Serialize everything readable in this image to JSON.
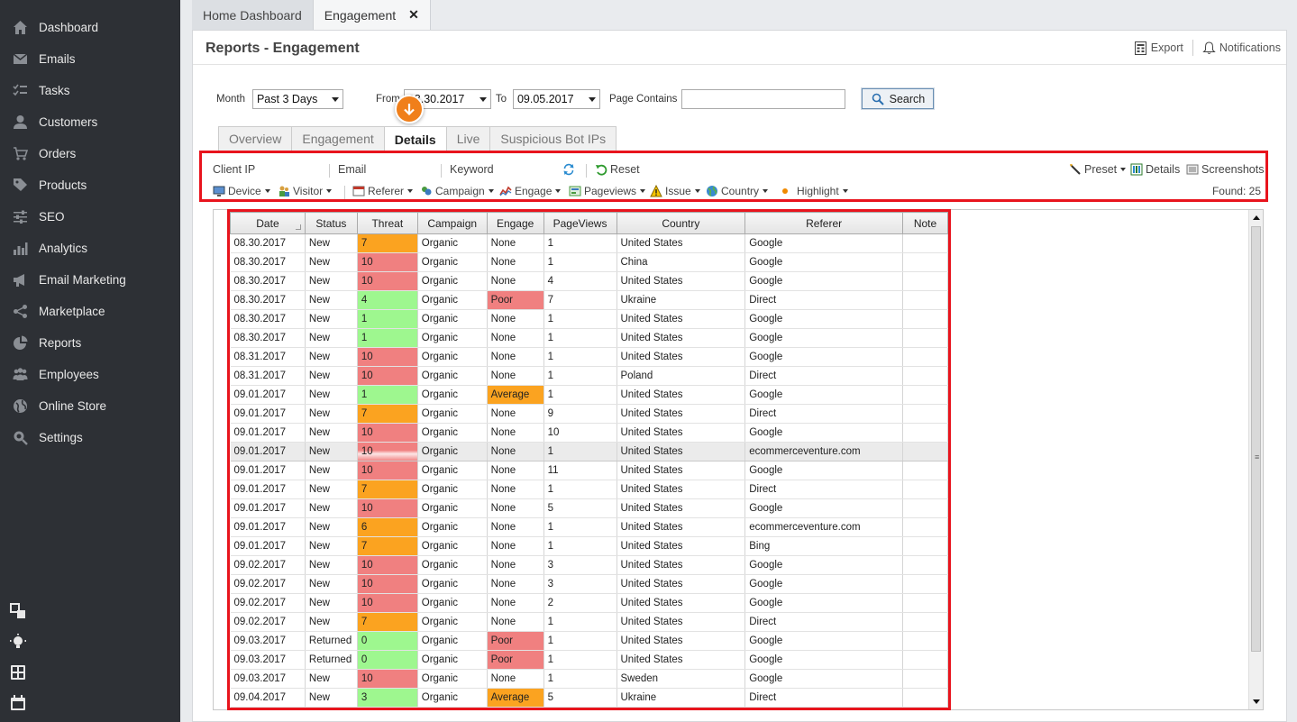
{
  "sidebar": {
    "items": [
      {
        "label": "Dashboard",
        "icon": "home-icon"
      },
      {
        "label": "Emails",
        "icon": "envelope-icon"
      },
      {
        "label": "Tasks",
        "icon": "tasks-icon"
      },
      {
        "label": "Customers",
        "icon": "user-icon"
      },
      {
        "label": "Orders",
        "icon": "cart-icon"
      },
      {
        "label": "Products",
        "icon": "tag-icon"
      },
      {
        "label": "SEO",
        "icon": "sliders-icon"
      },
      {
        "label": "Analytics",
        "icon": "bar-chart-icon"
      },
      {
        "label": "Email Marketing",
        "icon": "megaphone-icon"
      },
      {
        "label": "Marketplace",
        "icon": "share-icon"
      },
      {
        "label": "Reports",
        "icon": "pie-chart-icon"
      },
      {
        "label": "Employees",
        "icon": "group-icon"
      },
      {
        "label": "Online Store",
        "icon": "globe-icon"
      },
      {
        "label": "Settings",
        "icon": "gear-search-icon"
      }
    ]
  },
  "doc_tabs": {
    "home": "Home Dashboard",
    "engagement": "Engagement",
    "close": "✕"
  },
  "header": {
    "title": "Reports - Engagement",
    "export": "Export",
    "notifications": "Notifications"
  },
  "filters": {
    "month_label": "Month",
    "month_value": "Past 3 Days",
    "from_label": "From",
    "from_value": "08.30.2017",
    "to_label": "To",
    "to_value": "09.05.2017",
    "page_contains_label": "Page Contains",
    "page_contains_value": "",
    "search": "Search"
  },
  "sub_tabs": [
    "Overview",
    "Engagement",
    "Details",
    "Live",
    "Suspicious Bot IPs"
  ],
  "toolbar": {
    "client_ip": "Client IP",
    "email": "Email",
    "keyword": "Keyword",
    "reset": "Reset",
    "preset": "Preset",
    "details": "Details",
    "screenshots": "Screenshots",
    "device": "Device",
    "visitor": "Visitor",
    "referer": "Referer",
    "campaign": "Campaign",
    "engage": "Engage",
    "pageviews": "Pageviews",
    "issue": "Issue",
    "country": "Country",
    "highlight": "Highlight",
    "found": "Found: 25"
  },
  "grid": {
    "columns": [
      "Date",
      "Status",
      "Threat",
      "Campaign",
      "Engage",
      "PageViews",
      "Country",
      "Referer",
      "Note"
    ],
    "colors": {
      "orange": "#fba320",
      "red": "#f08080",
      "green": "#9ef78f"
    },
    "rows": [
      [
        "08.30.2017",
        "New",
        "7",
        "Organic",
        "None",
        "1",
        "United States",
        "Google",
        ""
      ],
      [
        "08.30.2017",
        "New",
        "10",
        "Organic",
        "None",
        "1",
        "China",
        "Google",
        ""
      ],
      [
        "08.30.2017",
        "New",
        "10",
        "Organic",
        "None",
        "4",
        "United States",
        "Google",
        ""
      ],
      [
        "08.30.2017",
        "New",
        "4",
        "Organic",
        "Poor",
        "7",
        "Ukraine",
        "Direct",
        ""
      ],
      [
        "08.30.2017",
        "New",
        "1",
        "Organic",
        "None",
        "1",
        "United States",
        "Google",
        ""
      ],
      [
        "08.30.2017",
        "New",
        "1",
        "Organic",
        "None",
        "1",
        "United States",
        "Google",
        ""
      ],
      [
        "08.31.2017",
        "New",
        "10",
        "Organic",
        "None",
        "1",
        "United States",
        "Google",
        ""
      ],
      [
        "08.31.2017",
        "New",
        "10",
        "Organic",
        "None",
        "1",
        "Poland",
        "Direct",
        ""
      ],
      [
        "09.01.2017",
        "New",
        "1",
        "Organic",
        "Average",
        "1",
        "United States",
        "Google",
        ""
      ],
      [
        "09.01.2017",
        "New",
        "7",
        "Organic",
        "None",
        "9",
        "United States",
        "Direct",
        ""
      ],
      [
        "09.01.2017",
        "New",
        "10",
        "Organic",
        "None",
        "10",
        "United States",
        "Google",
        ""
      ],
      [
        "09.01.2017",
        "New",
        "10",
        "Organic",
        "None",
        "1",
        "United States",
        "ecommerceventure.com",
        ""
      ],
      [
        "09.01.2017",
        "New",
        "10",
        "Organic",
        "None",
        "11",
        "United States",
        "Google",
        ""
      ],
      [
        "09.01.2017",
        "New",
        "7",
        "Organic",
        "None",
        "1",
        "United States",
        "Direct",
        ""
      ],
      [
        "09.01.2017",
        "New",
        "10",
        "Organic",
        "None",
        "5",
        "United States",
        "Google",
        ""
      ],
      [
        "09.01.2017",
        "New",
        "6",
        "Organic",
        "None",
        "1",
        "United States",
        "ecommerceventure.com",
        ""
      ],
      [
        "09.01.2017",
        "New",
        "7",
        "Organic",
        "None",
        "1",
        "United States",
        "Bing",
        ""
      ],
      [
        "09.02.2017",
        "New",
        "10",
        "Organic",
        "None",
        "3",
        "United States",
        "Google",
        ""
      ],
      [
        "09.02.2017",
        "New",
        "10",
        "Organic",
        "None",
        "3",
        "United States",
        "Google",
        ""
      ],
      [
        "09.02.2017",
        "New",
        "10",
        "Organic",
        "None",
        "2",
        "United States",
        "Google",
        ""
      ],
      [
        "09.02.2017",
        "New",
        "7",
        "Organic",
        "None",
        "1",
        "United States",
        "Direct",
        ""
      ],
      [
        "09.03.2017",
        "Returned",
        "0",
        "Organic",
        "Poor",
        "1",
        "United States",
        "Google",
        ""
      ],
      [
        "09.03.2017",
        "Returned",
        "0",
        "Organic",
        "Poor",
        "1",
        "United States",
        "Google",
        ""
      ],
      [
        "09.03.2017",
        "New",
        "10",
        "Organic",
        "None",
        "1",
        "Sweden",
        "Google",
        ""
      ],
      [
        "09.04.2017",
        "New",
        "3",
        "Organic",
        "Average",
        "5",
        "Ukraine",
        "Direct",
        ""
      ]
    ],
    "highlighted_row": 11
  }
}
